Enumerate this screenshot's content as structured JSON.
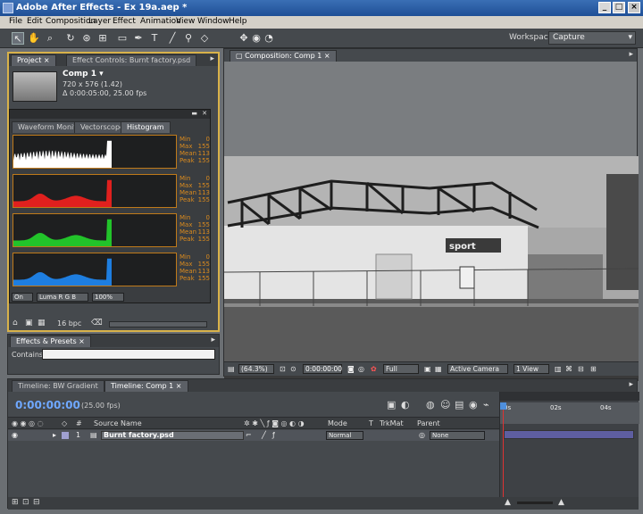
{
  "window": {
    "title": "Adobe After Effects - Ex 19a.aep *",
    "min_label": "_",
    "max_label": "□",
    "close_label": "×"
  },
  "menu": [
    "File",
    "Edit",
    "Composition",
    "Layer",
    "Effect",
    "Animation",
    "View",
    "Window",
    "Help"
  ],
  "toolbar": {
    "workspace_label": "Workspace:",
    "workspace_value": "Capture"
  },
  "project_panel": {
    "tabs": [
      "Project",
      "Effect Controls: Burnt factory.psd"
    ],
    "comp_name": "Comp 1 ▾",
    "comp_size": "720 x 576 (1.42)",
    "comp_duration": "Δ 0:00:05:00, 25.00 fps",
    "bpc": "16 bpc"
  },
  "histogram": {
    "tabs": [
      "Waveform Monitor",
      "Vectorscope",
      "Histogram"
    ],
    "channels": [
      {
        "name": "luma",
        "color": "#ffffff",
        "stats": {
          "Min": "0",
          "Max": "155",
          "Mean": "113",
          "Peak": "155"
        }
      },
      {
        "name": "red",
        "color": "#e0201e",
        "stats": {
          "Min": "0",
          "Max": "155",
          "Mean": "113",
          "Peak": "155"
        }
      },
      {
        "name": "green",
        "color": "#22c32a",
        "stats": {
          "Min": "0",
          "Max": "155",
          "Mean": "113",
          "Peak": "155"
        }
      },
      {
        "name": "blue",
        "color": "#1e7ee0",
        "stats": {
          "Min": "0",
          "Max": "155",
          "Mean": "113",
          "Peak": "155"
        }
      }
    ],
    "stat_labels": [
      "Min",
      "Max",
      "Mean",
      "Peak"
    ],
    "controls": [
      "On",
      "Luma R G B",
      "100%"
    ]
  },
  "effects_panel": {
    "tab": "Effects & Presets",
    "contains_label": "Contains:"
  },
  "composition_panel": {
    "tab": "Composition: Comp 1",
    "zoom": "(64.3%)",
    "timecode": "0:00:00:00",
    "resolution": "Full",
    "camera": "Active Camera",
    "view": "1 View"
  },
  "timeline": {
    "tabs": [
      "Timeline: BW Gradient",
      "Timeline: Comp 1"
    ],
    "timecode": "0:00:00:00",
    "fps": "(25.00 fps)",
    "headers": {
      "source_name": "Source Name",
      "mode": "Mode",
      "t": "T",
      "trkmat": "TrkMat",
      "parent": "Parent"
    },
    "layer": {
      "index": "1",
      "name": "Burnt factory.psd",
      "mode": "Normal",
      "parent": "None"
    },
    "ruler": [
      "0s",
      "02s",
      "04s"
    ]
  }
}
